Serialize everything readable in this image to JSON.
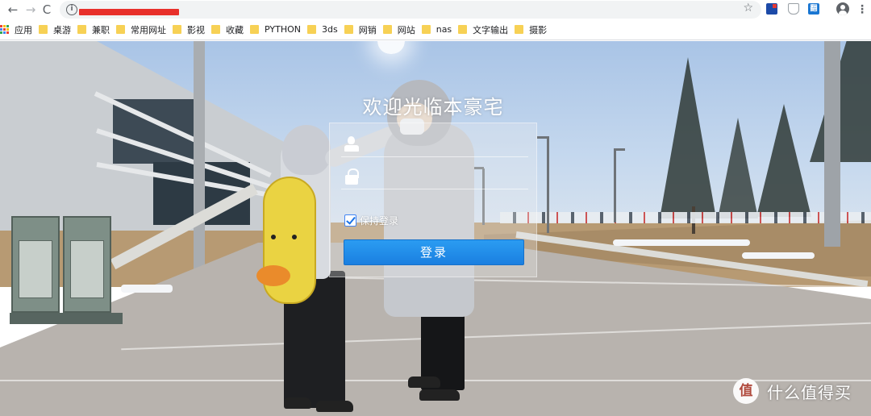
{
  "browser": {
    "url_text": "",
    "nav": {
      "back": "←",
      "forward": "→",
      "reload": "C"
    },
    "star": "☆",
    "extensions": [
      {
        "name": "bookmark-extension-icon",
        "label": ""
      },
      {
        "name": "shield-extension-icon",
        "label": ""
      },
      {
        "name": "translate-extension-icon",
        "label": "翻"
      }
    ],
    "menu": "⋮"
  },
  "bookmarks": {
    "apps_label": "应用",
    "apps_colors": [
      "#ea4335",
      "#fbbc05",
      "#34a853",
      "#4285f4",
      "#ea4335",
      "#fbbc05",
      "#34a853",
      "#4285f4",
      "#ea4335"
    ],
    "items": [
      {
        "label": "桌游"
      },
      {
        "label": "兼职"
      },
      {
        "label": "常用网址"
      },
      {
        "label": "影视"
      },
      {
        "label": "收藏"
      },
      {
        "label": "PYTHON"
      },
      {
        "label": "3ds"
      },
      {
        "label": "网销"
      },
      {
        "label": "网站"
      },
      {
        "label": "nas"
      },
      {
        "label": "文字输出"
      },
      {
        "label": "摄影"
      }
    ],
    "folder_color": "#f7d155"
  },
  "login": {
    "welcome": "欢迎光临本豪宅",
    "username_value": "",
    "username_placeholder": "",
    "password_value": "",
    "password_placeholder": "",
    "remember_label": "保持登录",
    "remember_checked": true,
    "submit_label": "登录",
    "button_color": "#1a7fe0"
  },
  "watermark": {
    "text": "什么值得买"
  },
  "colors": {
    "url_redaction": "#e8302b",
    "accent": "#1a73e8"
  }
}
